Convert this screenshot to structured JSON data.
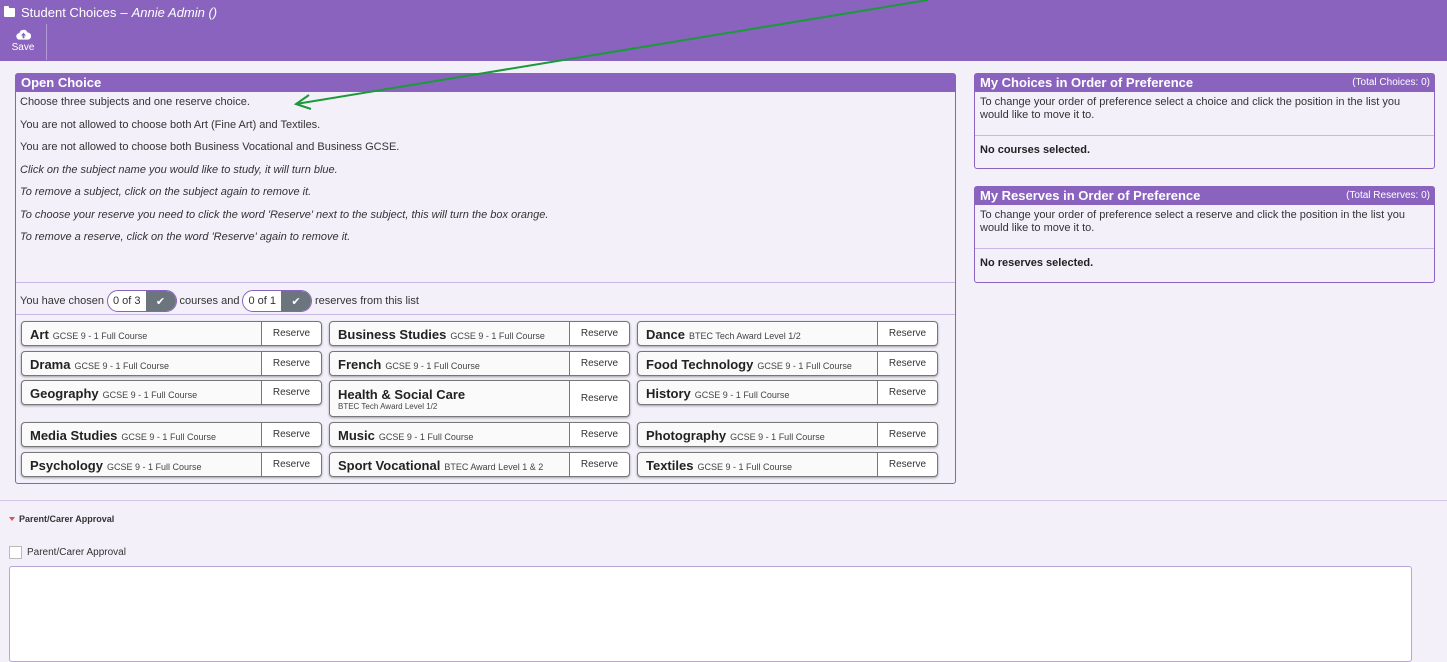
{
  "header": {
    "title": "Student Choices",
    "user": "Annie Admin ()",
    "save_label": "Save"
  },
  "open_choice": {
    "title": "Open Choice",
    "instructions": [
      "Choose three subjects and one reserve choice.",
      "You are not allowed to choose both Art (Fine Art) and Textiles.",
      "You are not allowed to choose both Business Vocational and Business GCSE.",
      "Click on the subject name you would like to study, it will turn blue.",
      "To remove a subject, click on the subject again to remove it.",
      "To choose your reserve you need to click the word 'Reserve' next to the subject, this will turn the box orange.",
      "To remove a reserve, click on the word 'Reserve' again to remove it."
    ],
    "chosen_prefix": "You have chosen",
    "chosen_courses": "0 of 3",
    "courses_and": "courses and",
    "chosen_reserves": "0 of 1",
    "reserves_suffix": "reserves from this list",
    "reserve_label": "Reserve",
    "courses": [
      {
        "name": "Art",
        "level": "GCSE 9 - 1 Full Course"
      },
      {
        "name": "Business Studies",
        "level": "GCSE 9 - 1 Full Course"
      },
      {
        "name": "Dance",
        "level": "BTEC Tech Award Level 1/2"
      },
      {
        "name": "Drama",
        "level": "GCSE 9 - 1 Full Course"
      },
      {
        "name": "French",
        "level": "GCSE 9 - 1 Full Course"
      },
      {
        "name": "Food Technology",
        "level": "GCSE 9 - 1 Full Course"
      },
      {
        "name": "Geography",
        "level": "GCSE 9 - 1 Full Course"
      },
      {
        "name": "Health & Social Care",
        "level": "BTEC Tech Award Level 1/2"
      },
      {
        "name": "History",
        "level": "GCSE 9 - 1 Full Course"
      },
      {
        "name": "Media Studies",
        "level": "GCSE 9 - 1 Full Course"
      },
      {
        "name": "Music",
        "level": "GCSE 9 - 1 Full Course"
      },
      {
        "name": "Photography",
        "level": "GCSE 9 - 1 Full Course"
      },
      {
        "name": "Psychology",
        "level": "GCSE 9 - 1 Full Course"
      },
      {
        "name": "Sport Vocational",
        "level": "BTEC Award Level 1 & 2"
      },
      {
        "name": "Textiles",
        "level": "GCSE 9 - 1 Full Course"
      }
    ]
  },
  "my_choices": {
    "title": "My Choices in Order of Preference",
    "total": "(Total Choices: 0)",
    "help": "To change your order of preference select a choice and click the position in the list you would like to move it to.",
    "empty": "No courses selected."
  },
  "my_reserves": {
    "title": "My Reserves in Order of Preference",
    "total": "(Total Reserves: 0)",
    "help": "To change your order of preference select a reserve and click the position in the list you would like to move it to.",
    "empty": "No reserves selected."
  },
  "approval": {
    "section_label": "Parent/Carer Approval",
    "checkbox_label": "Parent/Carer Approval",
    "notes_value": ""
  },
  "colors": {
    "brand_purple": "#8a63bf",
    "annotation_arrow": "#1a9a3a"
  }
}
